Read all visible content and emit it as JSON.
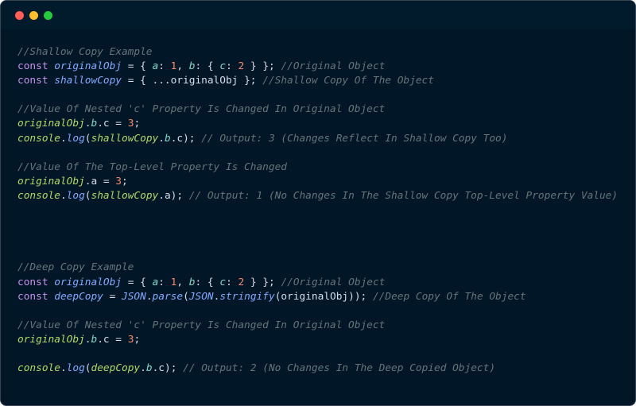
{
  "colors": {
    "background": "#011627",
    "titlebar": "#011a2c",
    "comment": "#637777",
    "keyword": "#c792ea",
    "definition": "#82aaff",
    "variable": "#addb67",
    "property": "#7fdbca",
    "number": "#f78c6c",
    "text": "#d6deeb"
  },
  "window_controls": [
    "close",
    "minimize",
    "maximize"
  ],
  "code_lines": [
    [
      {
        "t": "//Shallow Copy Example",
        "c": "comment"
      }
    ],
    [
      {
        "t": "const ",
        "c": "keyword"
      },
      {
        "t": "originalObj",
        "c": "def"
      },
      {
        "t": " = { ",
        "c": "punct"
      },
      {
        "t": "a",
        "c": "prop"
      },
      {
        "t": ": ",
        "c": "punct"
      },
      {
        "t": "1",
        "c": "number"
      },
      {
        "t": ", ",
        "c": "punct"
      },
      {
        "t": "b",
        "c": "prop"
      },
      {
        "t": ": { ",
        "c": "punct"
      },
      {
        "t": "c",
        "c": "prop"
      },
      {
        "t": ": ",
        "c": "punct"
      },
      {
        "t": "2",
        "c": "number"
      },
      {
        "t": " } }; ",
        "c": "punct"
      },
      {
        "t": "//Original Object",
        "c": "comment"
      }
    ],
    [
      {
        "t": "const ",
        "c": "keyword"
      },
      {
        "t": "shallowCopy",
        "c": "def"
      },
      {
        "t": " = { ...",
        "c": "punct"
      },
      {
        "t": "originalObj",
        "c": "plain"
      },
      {
        "t": " }; ",
        "c": "punct"
      },
      {
        "t": "//Shallow Copy Of The Object",
        "c": "comment"
      }
    ],
    [],
    [
      {
        "t": "//Value Of Nested 'c' Property Is Changed In Original Object",
        "c": "comment"
      }
    ],
    [
      {
        "t": "originalObj",
        "c": "var"
      },
      {
        "t": ".",
        "c": "punct"
      },
      {
        "t": "b",
        "c": "prop"
      },
      {
        "t": ".c = ",
        "c": "punct"
      },
      {
        "t": "3",
        "c": "number"
      },
      {
        "t": ";",
        "c": "punct"
      }
    ],
    [
      {
        "t": "console",
        "c": "var"
      },
      {
        "t": ".",
        "c": "punct"
      },
      {
        "t": "log",
        "c": "func"
      },
      {
        "t": "(",
        "c": "punct"
      },
      {
        "t": "shallowCopy",
        "c": "var"
      },
      {
        "t": ".",
        "c": "punct"
      },
      {
        "t": "b",
        "c": "prop"
      },
      {
        "t": ".c); ",
        "c": "punct"
      },
      {
        "t": "// Output: 3 (Changes Reflect In Shallow Copy Too)",
        "c": "comment"
      }
    ],
    [],
    [
      {
        "t": "//Value Of The Top-Level Property Is Changed",
        "c": "comment"
      }
    ],
    [
      {
        "t": "originalObj",
        "c": "var"
      },
      {
        "t": ".a = ",
        "c": "punct"
      },
      {
        "t": "3",
        "c": "number"
      },
      {
        "t": ";",
        "c": "punct"
      }
    ],
    [
      {
        "t": "console",
        "c": "var"
      },
      {
        "t": ".",
        "c": "punct"
      },
      {
        "t": "log",
        "c": "func"
      },
      {
        "t": "(",
        "c": "punct"
      },
      {
        "t": "shallowCopy",
        "c": "var"
      },
      {
        "t": ".a); ",
        "c": "punct"
      },
      {
        "t": "// Output: 1 (No Changes In The Shallow Copy Top-Level Property Value)",
        "c": "comment"
      }
    ],
    [],
    [],
    [],
    [],
    [
      {
        "t": "//Deep Copy Example",
        "c": "comment"
      }
    ],
    [
      {
        "t": "const ",
        "c": "keyword"
      },
      {
        "t": "originalObj",
        "c": "def"
      },
      {
        "t": " = { ",
        "c": "punct"
      },
      {
        "t": "a",
        "c": "prop"
      },
      {
        "t": ": ",
        "c": "punct"
      },
      {
        "t": "1",
        "c": "number"
      },
      {
        "t": ", ",
        "c": "punct"
      },
      {
        "t": "b",
        "c": "prop"
      },
      {
        "t": ": { ",
        "c": "punct"
      },
      {
        "t": "c",
        "c": "prop"
      },
      {
        "t": ": ",
        "c": "punct"
      },
      {
        "t": "2",
        "c": "number"
      },
      {
        "t": " } }; ",
        "c": "punct"
      },
      {
        "t": "//Original Object",
        "c": "comment"
      }
    ],
    [
      {
        "t": "const ",
        "c": "keyword"
      },
      {
        "t": "deepCopy",
        "c": "def"
      },
      {
        "t": " = ",
        "c": "punct"
      },
      {
        "t": "JSON",
        "c": "def"
      },
      {
        "t": ".",
        "c": "punct"
      },
      {
        "t": "parse",
        "c": "func"
      },
      {
        "t": "(",
        "c": "punct"
      },
      {
        "t": "JSON",
        "c": "def"
      },
      {
        "t": ".",
        "c": "punct"
      },
      {
        "t": "stringify",
        "c": "func"
      },
      {
        "t": "(originalObj)); ",
        "c": "punct"
      },
      {
        "t": "//Deep Copy Of The Object",
        "c": "comment"
      }
    ],
    [],
    [
      {
        "t": "//Value Of Nested 'c' Property Is Changed In Original Object",
        "c": "comment"
      }
    ],
    [
      {
        "t": "originalObj",
        "c": "var"
      },
      {
        "t": ".",
        "c": "punct"
      },
      {
        "t": "b",
        "c": "prop"
      },
      {
        "t": ".c = ",
        "c": "punct"
      },
      {
        "t": "3",
        "c": "number"
      },
      {
        "t": ";",
        "c": "punct"
      }
    ],
    [],
    [
      {
        "t": "console",
        "c": "var"
      },
      {
        "t": ".",
        "c": "punct"
      },
      {
        "t": "log",
        "c": "func"
      },
      {
        "t": "(",
        "c": "punct"
      },
      {
        "t": "deepCopy",
        "c": "var"
      },
      {
        "t": ".",
        "c": "punct"
      },
      {
        "t": "b",
        "c": "prop"
      },
      {
        "t": ".c); ",
        "c": "punct"
      },
      {
        "t": "// Output: 2 (No Changes In The Deep Copied Object)",
        "c": "comment"
      }
    ]
  ]
}
